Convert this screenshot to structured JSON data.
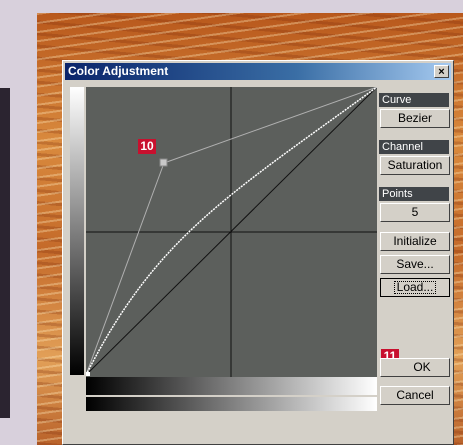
{
  "dialog": {
    "title": "Color Adjustment",
    "close_label": "×"
  },
  "sidebar": {
    "curve_label": "Curve",
    "curve_value": "Bezier",
    "channel_label": "Channel",
    "channel_value": "Saturation",
    "points_label": "Points",
    "points_value": "5",
    "initialize_label": "Initialize",
    "save_label": "Save...",
    "load_label": "Load...",
    "ok_label": "OK",
    "cancel_label": "Cancel"
  },
  "annotations": {
    "marker_10": "10",
    "marker_11": "11"
  },
  "colors": {
    "marker": "#c8102e",
    "curve_bg": "#5c5f5c",
    "title_bar": "#0a246a"
  },
  "icons": [
    "close-icon"
  ]
}
